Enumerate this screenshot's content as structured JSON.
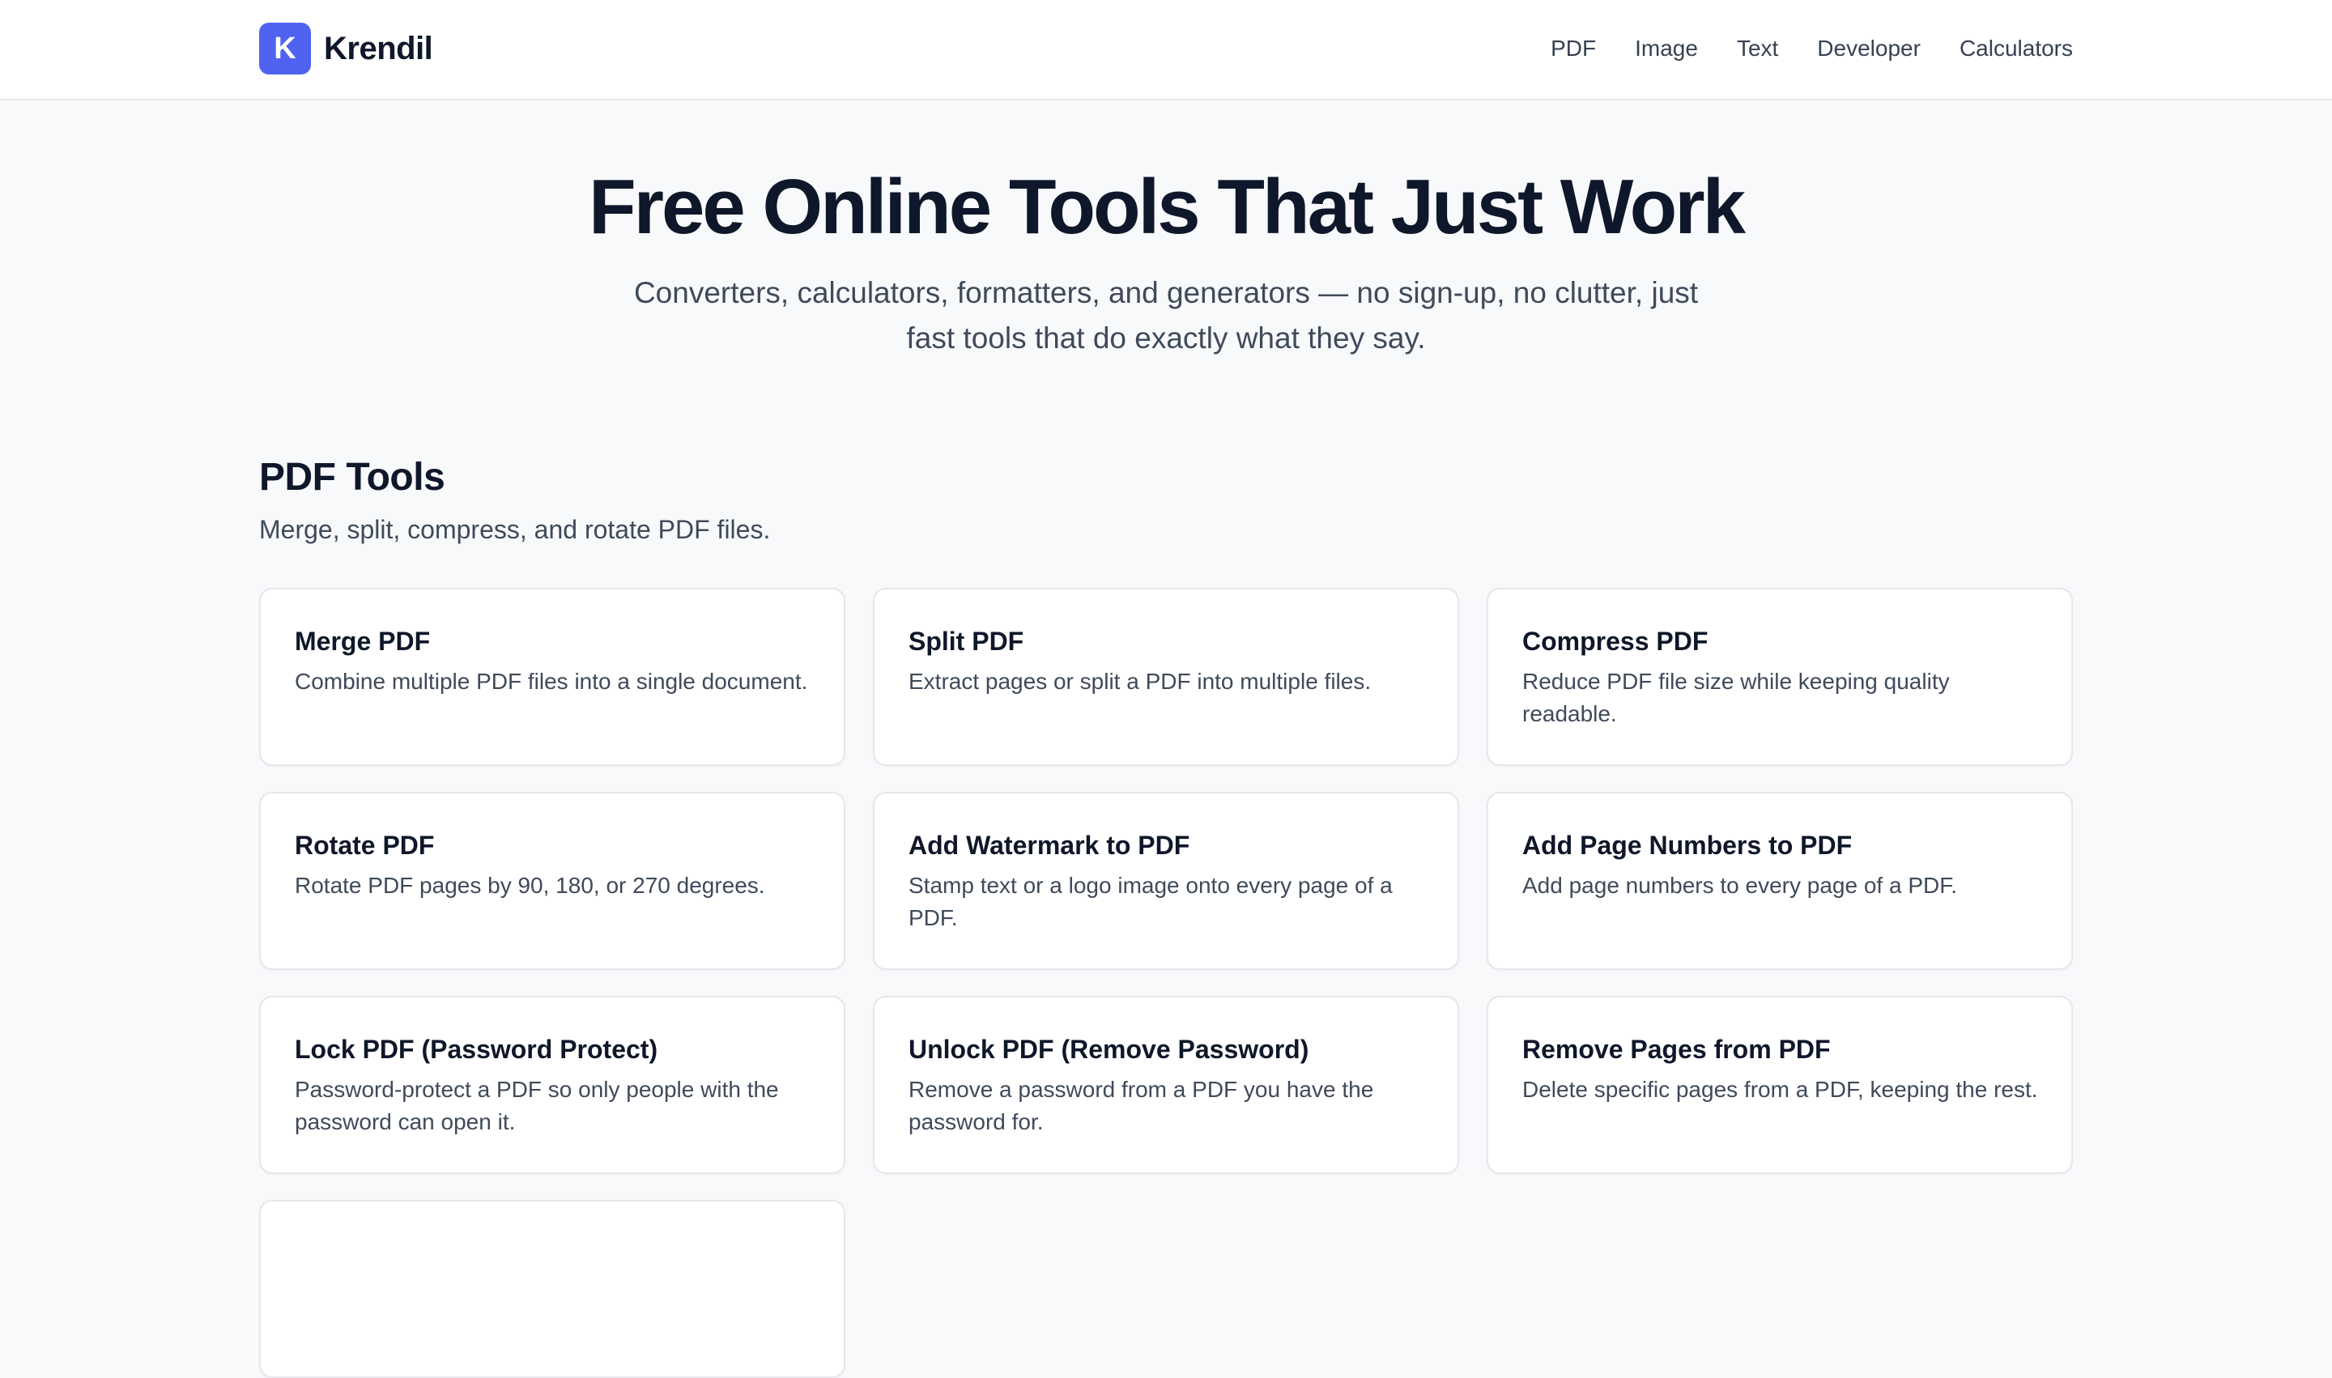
{
  "header": {
    "logo_letter": "K",
    "brand_name": "Krendil",
    "nav": [
      "PDF",
      "Image",
      "Text",
      "Developer",
      "Calculators"
    ]
  },
  "hero": {
    "title": "Free Online Tools That Just Work",
    "subtitle": "Converters, calculators, formatters, and generators — no sign-up, no clutter, just fast tools that do exactly what they say."
  },
  "section": {
    "title": "PDF Tools",
    "description": "Merge, split, compress, and rotate PDF files."
  },
  "cards": [
    {
      "title": "Merge PDF",
      "description": "Combine multiple PDF files into a single document."
    },
    {
      "title": "Split PDF",
      "description": "Extract pages or split a PDF into multiple files."
    },
    {
      "title": "Compress PDF",
      "description": "Reduce PDF file size while keeping quality readable."
    },
    {
      "title": "Rotate PDF",
      "description": "Rotate PDF pages by 90, 180, or 270 degrees."
    },
    {
      "title": "Add Watermark to PDF",
      "description": "Stamp text or a logo image onto every page of a PDF."
    },
    {
      "title": "Add Page Numbers to PDF",
      "description": "Add page numbers to every page of a PDF."
    },
    {
      "title": "Lock PDF (Password Protect)",
      "description": "Password-protect a PDF so only people with the password can open it."
    },
    {
      "title": "Unlock PDF (Remove Password)",
      "description": "Remove a password from a PDF you have the password for."
    },
    {
      "title": "Remove Pages from PDF",
      "description": "Delete specific pages from a PDF, keeping the rest."
    },
    {
      "title": "",
      "description": ""
    }
  ],
  "colors": {
    "accent": "#4f63f0",
    "page_background": "#f8f9fb",
    "heading": "#0f172a",
    "body_text": "#3f4a5a",
    "card_border": "#e5e7eb"
  }
}
